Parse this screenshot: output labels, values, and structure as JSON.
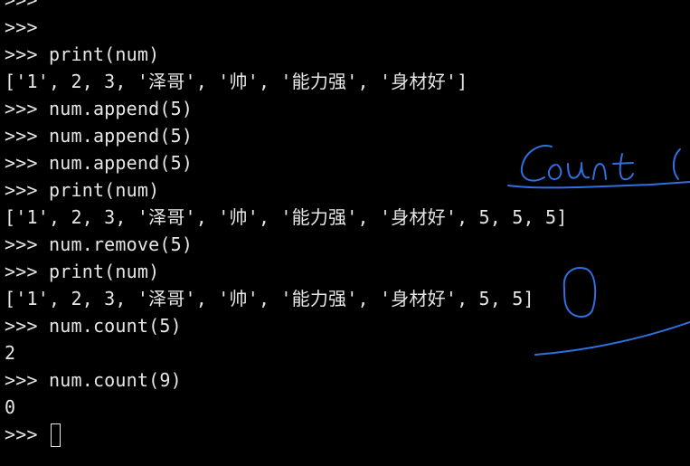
{
  "terminal": {
    "prompt": ">>>",
    "lines": [
      {
        "prompt": ">>>",
        "text": ""
      },
      {
        "prompt": ">>>",
        "text": ""
      },
      {
        "prompt": ">>>",
        "text": " print(num)"
      },
      {
        "prompt": "",
        "text": "['1', 2, 3, '泽哥', '帅', '能力强', '身材好']"
      },
      {
        "prompt": ">>>",
        "text": " num.append(5)"
      },
      {
        "prompt": ">>>",
        "text": " num.append(5)"
      },
      {
        "prompt": ">>>",
        "text": " num.append(5)"
      },
      {
        "prompt": ">>>",
        "text": " print(num)"
      },
      {
        "prompt": "",
        "text": "['1', 2, 3, '泽哥', '帅', '能力强', '身材好', 5, 5, 5]"
      },
      {
        "prompt": ">>>",
        "text": " num.remove(5)"
      },
      {
        "prompt": ">>>",
        "text": " print(num)"
      },
      {
        "prompt": "",
        "text": "['1', 2, 3, '泽哥', '帅', '能力强', '身材好', 5, 5]"
      },
      {
        "prompt": ">>>",
        "text": " num.count(5)"
      },
      {
        "prompt": "",
        "text": "2"
      },
      {
        "prompt": ">>>",
        "text": " num.count(9)"
      },
      {
        "prompt": "",
        "text": "0"
      },
      {
        "prompt": ">>>",
        "text": " "
      }
    ]
  },
  "annotation": {
    "handwriting": "Count (",
    "color": "#2f6fe0"
  },
  "colors": {
    "background": "#000000",
    "text": "#e6e6e6",
    "annotation": "#2f6fe0"
  }
}
